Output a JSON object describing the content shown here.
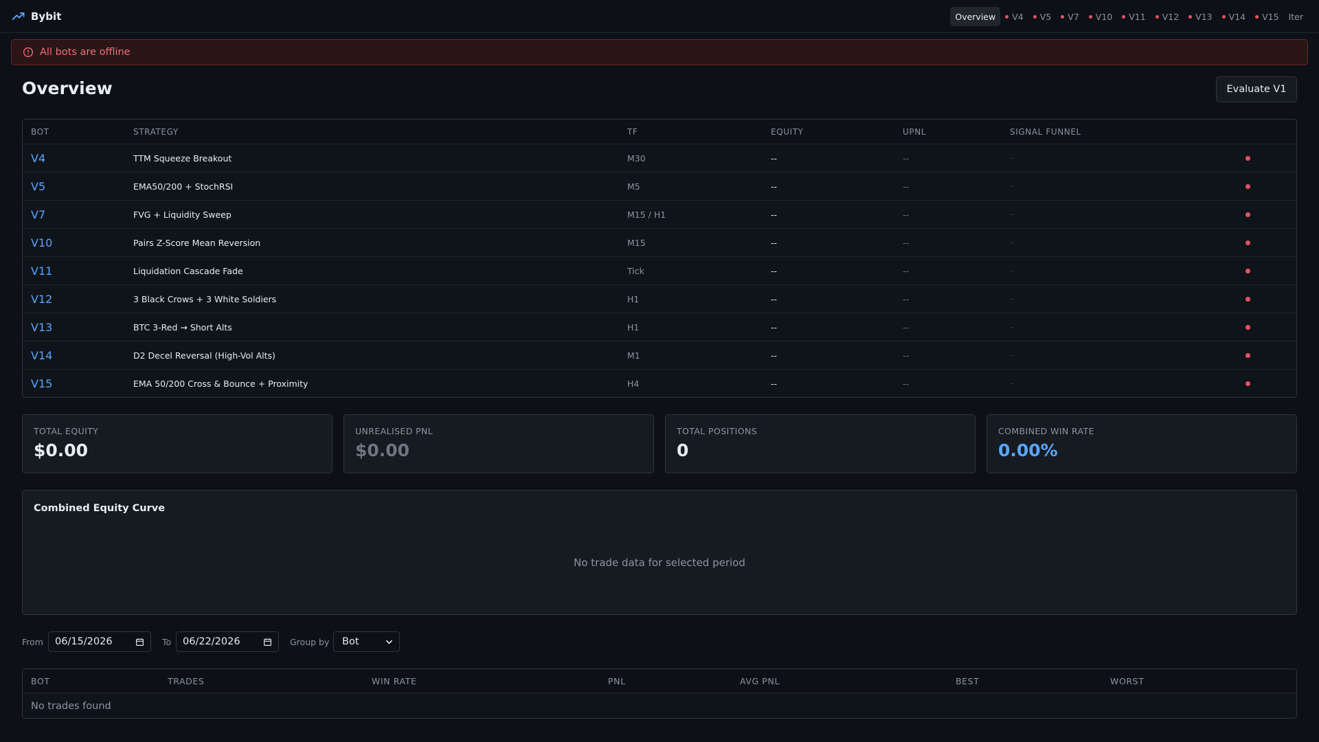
{
  "brand": {
    "name": "Bybit",
    "icon": "trending-up-icon",
    "accent": "#58a6ff"
  },
  "nav": {
    "items": [
      {
        "label": "Overview",
        "active": true,
        "dot": false
      },
      {
        "label": "V4",
        "active": false,
        "dot": true
      },
      {
        "label": "V5",
        "active": false,
        "dot": true
      },
      {
        "label": "V7",
        "active": false,
        "dot": true
      },
      {
        "label": "V10",
        "active": false,
        "dot": true
      },
      {
        "label": "V11",
        "active": false,
        "dot": true
      },
      {
        "label": "V12",
        "active": false,
        "dot": true
      },
      {
        "label": "V13",
        "active": false,
        "dot": true
      },
      {
        "label": "V14",
        "active": false,
        "dot": true
      },
      {
        "label": "V15",
        "active": false,
        "dot": true
      },
      {
        "label": "Iter",
        "active": false,
        "dot": false
      }
    ]
  },
  "alert": {
    "text": "All bots are offline",
    "icon": "alert-circle-icon",
    "color": "#f0707a"
  },
  "page": {
    "title": "Overview",
    "evaluate_label": "Evaluate V1"
  },
  "bots_table": {
    "headers": {
      "bot": "BOT",
      "strategy": "STRATEGY",
      "tf": "TF",
      "equity": "EQUITY",
      "upnl": "UPNL",
      "funnel": "SIGNAL FUNNEL"
    },
    "rows": [
      {
        "bot": "V4",
        "strategy": "TTM Squeeze Breakout",
        "tf": "M30",
        "equity": "--",
        "upnl": "--",
        "funnel": "–",
        "status": "offline"
      },
      {
        "bot": "V5",
        "strategy": "EMA50/200 + StochRSI",
        "tf": "M5",
        "equity": "--",
        "upnl": "--",
        "funnel": "–",
        "status": "offline"
      },
      {
        "bot": "V7",
        "strategy": "FVG + Liquidity Sweep",
        "tf": "M15 / H1",
        "equity": "--",
        "upnl": "--",
        "funnel": "–",
        "status": "offline"
      },
      {
        "bot": "V10",
        "strategy": "Pairs Z-Score Mean Reversion",
        "tf": "M15",
        "equity": "--",
        "upnl": "--",
        "funnel": "–",
        "status": "offline"
      },
      {
        "bot": "V11",
        "strategy": "Liquidation Cascade Fade",
        "tf": "Tick",
        "equity": "--",
        "upnl": "--",
        "funnel": "–",
        "status": "offline"
      },
      {
        "bot": "V12",
        "strategy": "3 Black Crows + 3 White Soldiers",
        "tf": "H1",
        "equity": "--",
        "upnl": "--",
        "funnel": "–",
        "status": "offline"
      },
      {
        "bot": "V13",
        "strategy": "BTC 3-Red → Short Alts",
        "tf": "H1",
        "equity": "--",
        "upnl": "--",
        "funnel": "–",
        "status": "offline"
      },
      {
        "bot": "V14",
        "strategy": "D2 Decel Reversal (High-Vol Alts)",
        "tf": "M1",
        "equity": "--",
        "upnl": "--",
        "funnel": "–",
        "status": "offline"
      },
      {
        "bot": "V15",
        "strategy": "EMA 50/200 Cross & Bounce + Proximity",
        "tf": "H4",
        "equity": "--",
        "upnl": "--",
        "funnel": "–",
        "status": "offline"
      }
    ]
  },
  "stats": [
    {
      "label": "TOTAL EQUITY",
      "value": "$0.00",
      "tone": "white"
    },
    {
      "label": "UNREALISED PNL",
      "value": "$0.00",
      "tone": "gray"
    },
    {
      "label": "TOTAL POSITIONS",
      "value": "0",
      "tone": "white"
    },
    {
      "label": "COMBINED WIN RATE",
      "value": "0.00%",
      "tone": "blue"
    }
  ],
  "equity_curve": {
    "title": "Combined Equity Curve",
    "empty_text": "No trade data for selected period"
  },
  "filters": {
    "from_label": "From",
    "from_value": "06/15/2026",
    "to_label": "To",
    "to_value": "06/22/2026",
    "group_label": "Group by",
    "group_value": "Bot"
  },
  "trades_table": {
    "headers": [
      "BOT",
      "TRADES",
      "WIN RATE",
      "PNL",
      "AVG PNL",
      "BEST",
      "WORST"
    ],
    "empty_text": "No trades found"
  },
  "colors": {
    "offline": "#f0535e",
    "background": "#0d1117",
    "card": "#161b22",
    "border": "#30363d"
  }
}
